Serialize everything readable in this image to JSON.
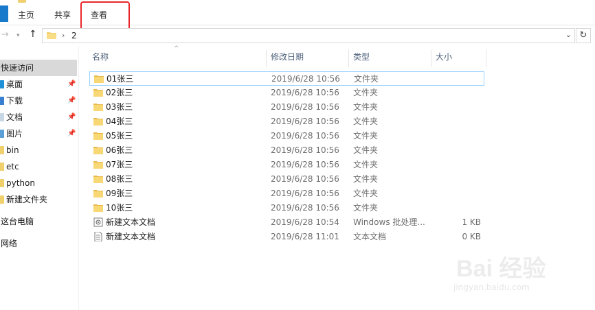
{
  "ribbon": {
    "tabs": [
      {
        "label": "主页"
      },
      {
        "label": "共享"
      },
      {
        "label": "查看"
      }
    ]
  },
  "address_bar": {
    "path": "2"
  },
  "nav_pane": {
    "quick_access": "快速访问",
    "items": [
      {
        "label": "桌面",
        "pinned": true,
        "icon": "desktop-icon"
      },
      {
        "label": "下载",
        "pinned": true,
        "icon": "download-icon"
      },
      {
        "label": "文档",
        "pinned": true,
        "icon": "documents-icon"
      },
      {
        "label": "图片",
        "pinned": true,
        "icon": "pictures-icon"
      },
      {
        "label": "bin",
        "pinned": false,
        "icon": "folder-icon"
      },
      {
        "label": "etc",
        "pinned": false,
        "icon": "folder-icon"
      },
      {
        "label": "python",
        "pinned": false,
        "icon": "folder-icon"
      },
      {
        "label": "新建文件夹",
        "pinned": false,
        "icon": "folder-icon"
      }
    ],
    "this_pc": "这台电脑",
    "network": "网络"
  },
  "columns": {
    "name": "名称",
    "date": "修改日期",
    "type": "类型",
    "size": "大小"
  },
  "files": [
    {
      "name": "01张三",
      "date": "2019/6/28 10:56",
      "type": "文件夹",
      "size": "",
      "icon": "folder-icon"
    },
    {
      "name": "02张三",
      "date": "2019/6/28 10:56",
      "type": "文件夹",
      "size": "",
      "icon": "folder-icon"
    },
    {
      "name": "03张三",
      "date": "2019/6/28 10:56",
      "type": "文件夹",
      "size": "",
      "icon": "folder-icon"
    },
    {
      "name": "04张三",
      "date": "2019/6/28 10:56",
      "type": "文件夹",
      "size": "",
      "icon": "folder-icon"
    },
    {
      "name": "05张三",
      "date": "2019/6/28 10:56",
      "type": "文件夹",
      "size": "",
      "icon": "folder-icon"
    },
    {
      "name": "06张三",
      "date": "2019/6/28 10:56",
      "type": "文件夹",
      "size": "",
      "icon": "folder-icon"
    },
    {
      "name": "07张三",
      "date": "2019/6/28 10:56",
      "type": "文件夹",
      "size": "",
      "icon": "folder-icon"
    },
    {
      "name": "08张三",
      "date": "2019/6/28 10:56",
      "type": "文件夹",
      "size": "",
      "icon": "folder-icon"
    },
    {
      "name": "09张三",
      "date": "2019/6/28 10:56",
      "type": "文件夹",
      "size": "",
      "icon": "folder-icon"
    },
    {
      "name": "10张三",
      "date": "2019/6/28 10:56",
      "type": "文件夹",
      "size": "",
      "icon": "folder-icon"
    },
    {
      "name": "新建文本文档",
      "date": "2019/6/28 10:54",
      "type": "Windows 批处理...",
      "size": "1 KB",
      "icon": "batch-file-icon"
    },
    {
      "name": "新建文本文档",
      "date": "2019/6/28 11:01",
      "type": "文本文档",
      "size": "0 KB",
      "icon": "text-file-icon"
    }
  ],
  "watermark": {
    "brand": "Bai 经验",
    "url": "jingyan.baidu.com"
  },
  "colors": {
    "accent": "#1979ca",
    "annotation_box": "#e8262a",
    "folder": "#f0cf6d",
    "selection_border": "#99d1ff"
  }
}
